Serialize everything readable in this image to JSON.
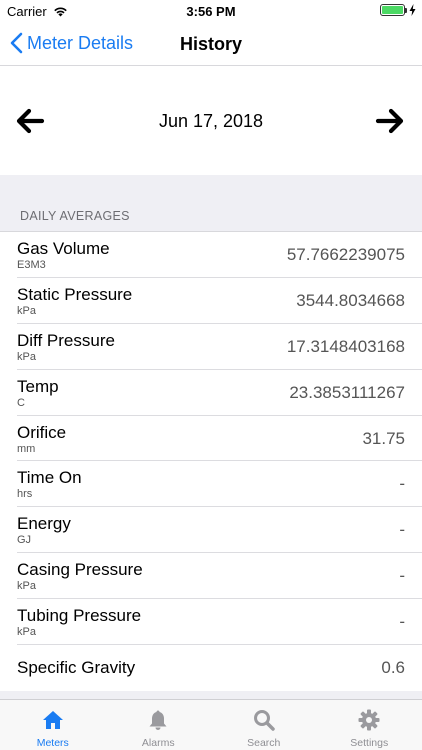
{
  "status_bar": {
    "carrier": "Carrier",
    "time": "3:56 PM"
  },
  "nav": {
    "back_label": "Meter Details",
    "title": "History"
  },
  "date_picker": {
    "date": "Jun 17, 2018",
    "prev_icon": "arrow-left-icon",
    "next_icon": "arrow-right-icon"
  },
  "section": {
    "header": "DAILY AVERAGES"
  },
  "rows": [
    {
      "label": "Gas Volume",
      "unit": "E3M3",
      "value": "57.7662239075"
    },
    {
      "label": "Static Pressure",
      "unit": "kPa",
      "value": "3544.8034668"
    },
    {
      "label": "Diff Pressure",
      "unit": "kPa",
      "value": "17.3148403168"
    },
    {
      "label": "Temp",
      "unit": "C",
      "value": "23.3853111267"
    },
    {
      "label": "Orifice",
      "unit": "mm",
      "value": "31.75"
    },
    {
      "label": "Time On",
      "unit": "hrs",
      "value": "-"
    },
    {
      "label": "Energy",
      "unit": "GJ",
      "value": "-"
    },
    {
      "label": "Casing Pressure",
      "unit": "kPa",
      "value": "-"
    },
    {
      "label": "Tubing Pressure",
      "unit": "kPa",
      "value": "-"
    },
    {
      "label": "Specific Gravity",
      "unit": "",
      "value": "0.6"
    }
  ],
  "tabs": [
    {
      "label": "Meters",
      "icon": "home-icon",
      "active": true
    },
    {
      "label": "Alarms",
      "icon": "bell-icon",
      "active": false
    },
    {
      "label": "Search",
      "icon": "search-icon",
      "active": false
    },
    {
      "label": "Settings",
      "icon": "gear-icon",
      "active": false
    }
  ],
  "colors": {
    "accent": "#1a7cf2",
    "inactive_tab": "#9a9a9e",
    "grouped_background": "#efeff4",
    "battery": "#4cd964"
  }
}
